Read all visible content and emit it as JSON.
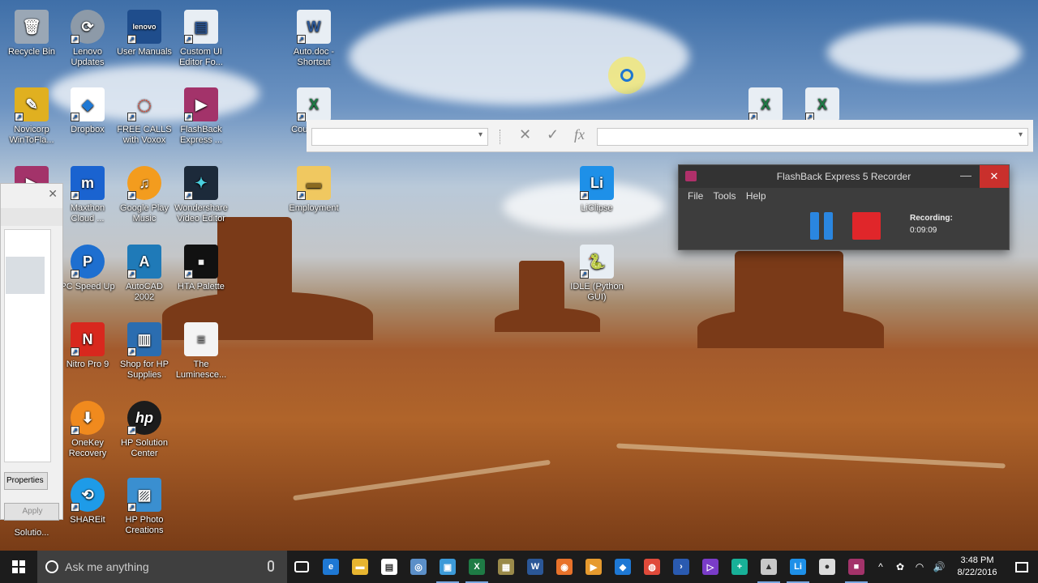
{
  "desktop": {
    "icons": [
      {
        "label": "Recycle Bin",
        "icon": "recycle-bin-icon",
        "color": "#9aa7b5"
      },
      {
        "label": "Lenovo Updates",
        "icon": "lenovo-updates-icon",
        "color": "#8d9aa8"
      },
      {
        "label": "User Manuals",
        "icon": "user-manuals-icon",
        "color": "#1f4d8c"
      },
      {
        "label": "Custom UI Editor Fo...",
        "icon": "document-icon",
        "color": "#e8eef4"
      },
      {
        "label": "Auto.doc - Shortcut",
        "icon": "word-doc-icon",
        "color": "#e8eef4"
      },
      {
        "label": "Novicorp WinToFla...",
        "icon": "novicorp-icon",
        "color": "#e0b020"
      },
      {
        "label": "Dropbox",
        "icon": "dropbox-icon",
        "color": "#ffffff"
      },
      {
        "label": "FREE CALLS with Voxox",
        "icon": "voxox-icon",
        "color": "#e8412c"
      },
      {
        "label": "FlashBack Express ...",
        "icon": "flashback-icon",
        "color": "#a3336a"
      },
      {
        "label": "Cou... - S...",
        "icon": "excel-file-icon",
        "color": "#e8eef4"
      },
      {
        "label": "Maxthon Cloud ...",
        "icon": "maxthon-icon",
        "color": "#1a63d0"
      },
      {
        "label": "Google Play Music",
        "icon": "google-play-music-icon",
        "color": "#f39c1e"
      },
      {
        "label": "Wondershare Video Editor",
        "icon": "wondershare-icon",
        "color": "#1c2a3a"
      },
      {
        "label": "Employment",
        "icon": "folder-icon",
        "color": "#f0c860"
      },
      {
        "label": "LiClipse",
        "icon": "liclipse-icon",
        "color": "#1e90e8"
      },
      {
        "label": "PC Speed Up",
        "icon": "pc-speed-up-icon",
        "color": "#1e6fd0"
      },
      {
        "label": "AutoCAD 2002",
        "icon": "autocad-icon",
        "color": "#1f7ab8"
      },
      {
        "label": "HTA Palette",
        "icon": "hta-palette-icon",
        "color": "#111111"
      },
      {
        "label": "IDLE (Python GUI)",
        "icon": "python-idle-icon",
        "color": "#e8eef4"
      },
      {
        "label": "Nitro Pro 9",
        "icon": "nitro-pro-icon",
        "color": "#d8281e"
      },
      {
        "label": "Shop for HP Supplies",
        "icon": "hp-supplies-icon",
        "color": "#2b6db0"
      },
      {
        "label": "The Luminesce...",
        "icon": "text-file-icon",
        "color": "#f4f4f4"
      },
      {
        "label": "OneKey Recovery",
        "icon": "onekey-recovery-icon",
        "color": "#f08a1e"
      },
      {
        "label": "HP Solution Center",
        "icon": "hp-solution-center-icon",
        "color": "#1c1c1c"
      },
      {
        "label": "SHAREit",
        "icon": "shareit-icon",
        "color": "#1e9be8"
      },
      {
        "label": "HP Photo Creations",
        "icon": "hp-photo-creations-icon",
        "color": "#3a8fd0"
      },
      {
        "label": "Solutio...",
        "icon": "",
        "color": ""
      }
    ]
  },
  "excel_bar": {
    "cancel_glyph": "✕",
    "enter_glyph": "✓",
    "fx_glyph": "fx"
  },
  "dialog": {
    "close_glyph": "✕",
    "properties_label": "Properties",
    "apply_label": "Apply"
  },
  "recorder": {
    "title": "FlashBack Express 5 Recorder",
    "minimize_glyph": "—",
    "close_glyph": "✕",
    "menu": [
      "File",
      "Tools",
      "Help"
    ],
    "recording_label": "Recording:",
    "elapsed": "0:09:09",
    "stop_color": "#e0262a",
    "pause_color": "#2a86e0"
  },
  "taskbar": {
    "search_placeholder": "Ask me anything",
    "apps": [
      {
        "name": "task-view",
        "glyph": "▭",
        "color": "#1c1c1c"
      },
      {
        "name": "edge",
        "glyph": "e",
        "color": "#1e78d4"
      },
      {
        "name": "file-explorer",
        "glyph": "▬",
        "color": "#e8b530"
      },
      {
        "name": "store",
        "glyph": "▤",
        "color": "#ffffff"
      },
      {
        "name": "outlook-app",
        "glyph": "◎",
        "color": "#5b8fc8"
      },
      {
        "name": "image-viewer",
        "glyph": "▣",
        "color": "#3c9ad8"
      },
      {
        "name": "excel",
        "glyph": "X",
        "color": "#1e7b45"
      },
      {
        "name": "install-app",
        "glyph": "▦",
        "color": "#9a8a4a"
      },
      {
        "name": "word",
        "glyph": "W",
        "color": "#2b5797"
      },
      {
        "name": "firefox",
        "glyph": "◉",
        "color": "#e8722a"
      },
      {
        "name": "media-player",
        "glyph": "▶",
        "color": "#e69a2e"
      },
      {
        "name": "dropbox",
        "glyph": "◆",
        "color": "#1e78d4"
      },
      {
        "name": "chrome",
        "glyph": "◍",
        "color": "#e04a3a"
      },
      {
        "name": "powershell",
        "glyph": "›",
        "color": "#2a5ab0"
      },
      {
        "name": "visual-studio",
        "glyph": "▷",
        "color": "#7a3cc8"
      },
      {
        "name": "plus-app",
        "glyph": "+",
        "color": "#18b098"
      },
      {
        "name": "paint",
        "glyph": "▲",
        "color": "#c8c8c8"
      },
      {
        "name": "liclipse",
        "glyph": "Li",
        "color": "#1e90e8"
      },
      {
        "name": "python",
        "glyph": "●",
        "color": "#dcdcdc"
      },
      {
        "name": "flashback",
        "glyph": "■",
        "color": "#a3336a"
      }
    ],
    "tray_icons": [
      "^",
      "✿",
      "◠",
      "🔊"
    ],
    "time": "3:48 PM",
    "date": "8/22/2016"
  }
}
